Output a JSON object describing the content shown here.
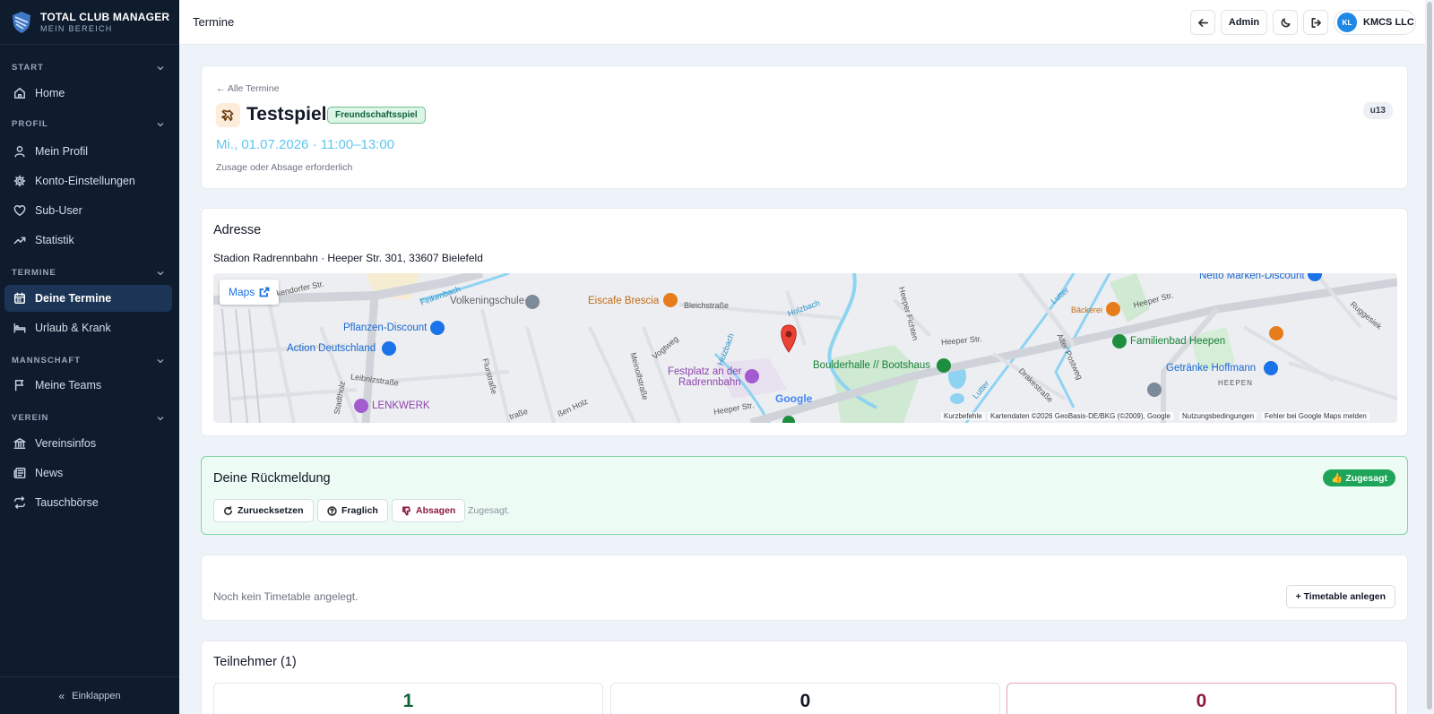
{
  "brand": {
    "title": "TOTAL CLUB MANAGER",
    "subtitle": "MEIN BEREICH"
  },
  "sidebar": {
    "sections": [
      {
        "label": "START",
        "items": [
          {
            "label": "Home",
            "icon": "home-icon"
          }
        ]
      },
      {
        "label": "PROFIL",
        "items": [
          {
            "label": "Mein Profil",
            "icon": "user-icon"
          },
          {
            "label": "Konto-Einstellungen",
            "icon": "gear-icon"
          },
          {
            "label": "Sub-User",
            "icon": "heart-icon"
          },
          {
            "label": "Statistik",
            "icon": "trend-icon"
          }
        ]
      },
      {
        "label": "TERMINE",
        "items": [
          {
            "label": "Deine Termine",
            "icon": "calendar-icon",
            "active": true
          },
          {
            "label": "Urlaub & Krank",
            "icon": "bed-icon"
          }
        ]
      },
      {
        "label": "MANNSCHAFT",
        "items": [
          {
            "label": "Meine Teams",
            "icon": "flag-icon"
          }
        ]
      },
      {
        "label": "VEREIN",
        "items": [
          {
            "label": "Vereinsinfos",
            "icon": "bank-icon"
          },
          {
            "label": "News",
            "icon": "newspaper-icon"
          },
          {
            "label": "Tauschbörse",
            "icon": "swap-icon"
          }
        ]
      }
    ],
    "collapse_label": "Einklappen"
  },
  "topbar": {
    "title": "Termine",
    "admin_label": "Admin",
    "user_initials": "KL",
    "user_name": "KMCS LLC"
  },
  "event": {
    "back_label": "← Alle Termine",
    "title": "Testspiel",
    "type_badge": "Freundschaftsspiel",
    "datetime": "Mi., 01.07.2026 · 11:00–13:00",
    "note": "Zusage oder Absage erforderlich",
    "team_tag": "u13"
  },
  "address": {
    "heading": "Adresse",
    "text": "Stadion Radrennbahn · Heeper Str. 301, 33607 Bielefeld",
    "maps_label": "Maps",
    "map_places": {
      "volkeningschule": "Volkeningschule",
      "eiscafe": "Eiscafe Brescia",
      "pflanzen": "Pflanzen-Discount",
      "action": "Action Deutschland",
      "festplatz1": "Festplatz an der",
      "festplatz2": "Radrennbahn",
      "lenkwerk": "LENKWERK",
      "boulderhalle": "Boulderhalle // Bootshaus",
      "netto": "Netto Marken-Discount",
      "baeckerei": "Bäckerei",
      "familienbad": "Familienbad Heepen",
      "getraenke": "Getränke Hoffmann",
      "heepen": "HEEPEN"
    },
    "map_streets": {
      "kendorfer": "kendorfer Str.",
      "finkenbach": "Finkenbach",
      "bleichstrasse": "Bleichstraße",
      "holzbach1": "Holzbach",
      "holzbach2": "Holzbach",
      "vogtweg": "Vogtweg",
      "flurstrasse": "Flurstraße",
      "meinolf": "Meinolfstraße",
      "leibniz": "Leibnizstraße",
      "stadtholz": "Stadtholz",
      "heeper1": "Heeper Str.",
      "heeper2": "Heeper Str.",
      "heeper3": "Heeper Str.",
      "heeper_fichten": "Heeper Fichten",
      "lutter1": "Lutter",
      "lutter2": "Lutter",
      "alter_postweg": "Alter Postweg",
      "drake": "Drakestraße",
      "ruggesiek": "Ruggesiek",
      "holz": "ßen Holz",
      "strasse": "traße"
    },
    "google_logo": "Google",
    "attribution": {
      "shortcuts": "Kurzbefehle",
      "data": "Kartendaten ©2026 GeoBasis-DE/BKG (©2009), Google",
      "terms": "Nutzungsbedingungen",
      "report": "Fehler bei Google Maps melden"
    }
  },
  "rsvp": {
    "heading": "Deine Rückmeldung",
    "status_badge": "👍 Zugesagt",
    "reset_label": "Zuruecksetzen",
    "maybe_label": "Fraglich",
    "decline_label": "Absagen",
    "status_text": "Zugesagt."
  },
  "timetable": {
    "empty_text": "Noch kein Timetable angelegt.",
    "create_label": "+ Timetable anlegen"
  },
  "participants": {
    "heading": "Teilnehmer (1)",
    "stats": [
      {
        "value": "1",
        "color": "#11623a"
      },
      {
        "value": "0",
        "color": "#111827"
      },
      {
        "value": "0",
        "color": "#8e1c3e"
      }
    ]
  }
}
